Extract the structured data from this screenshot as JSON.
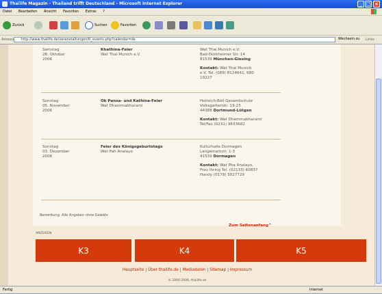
{
  "window": {
    "title": "Thailife Magazin - Thailand trifft Deutschland - Microsoft Internet Explorer",
    "min": "_",
    "max": "□",
    "close": "×"
  },
  "menu": [
    "Datei",
    "Bearbeiten",
    "Ansicht",
    "Favoriten",
    "Extras",
    "?"
  ],
  "toolbar": {
    "back": "Zurück",
    "search": "Suchen",
    "favorites": "Favoriten"
  },
  "address": {
    "label": "Adresse",
    "url": "http://www.thailife.de/veranstaltungen/tl_events.php?calendar=de",
    "go": "Wechseln zu",
    "links": "Links"
  },
  "events": [
    {
      "day": "Samstag",
      "date": "28. Oktober",
      "year": "2006",
      "title": "Khathina-Feier",
      "org": "Wat Thai Munich e.V.",
      "venue": [
        "Wat Thai Munich e.V.",
        "Bad-Dürkheimer Str. 14"
      ],
      "city_zip": "81539",
      "city": "München-Giesing",
      "contact_label": "Kontakt:",
      "contact": [
        "Wat Thai Munich",
        "e.V. Tel. (089) 8124641, 680",
        "19227"
      ]
    },
    {
      "day": "Sonntag",
      "date": "05. November",
      "year": "2006",
      "title": "Ok Pansa- und Kathina-Feier",
      "org": "Wat Dhammabharami",
      "venue": [
        "Heinrich-Böll Gesamtschule",
        "Volksgartenstr. 19-23"
      ],
      "city_zip": "44388",
      "city": "Dortmund-Lütgen",
      "contact_label": "Kontakt:",
      "contact": [
        "Wat Dhammabharami",
        "Tel/Fax (0231) 9633682"
      ]
    },
    {
      "day": "Sonntag",
      "date": "03. Dezember",
      "year": "2006",
      "title": "Feier des Königsgeburtstags",
      "org": "Wat Pah Analayo",
      "venue": [
        "Kulturhalle Dormagen",
        "Langemarkstr. 1-3"
      ],
      "city_zip": "41539",
      "city": "Dormagen",
      "contact_label": "Kontakt:",
      "contact": [
        "Wat Pha Analayo,",
        "Frau Ihring Tel. (02133) 60837",
        "Handy (0179) 5027729"
      ]
    }
  ],
  "remark": "Bemerkung: Alle Angaben ohne Gewähr",
  "top_link": "Zum Seitenanfang^",
  "ads_label": "ANZEIGEN",
  "ads": [
    "K3",
    "K4",
    "K5"
  ],
  "footer": {
    "links": [
      "Hauptseite",
      "Über thailife.de",
      "Mediadaten",
      "Sitemap",
      "Impressum"
    ],
    "separator": "|",
    "copyright": "© 2000-2006, thailife.de"
  },
  "status": {
    "left": "Fertig",
    "right": "Internet"
  },
  "colors": {
    "accent": "#d43a0a",
    "page_bg": "#f5ebd8",
    "content_bg": "#fbf6ec"
  }
}
